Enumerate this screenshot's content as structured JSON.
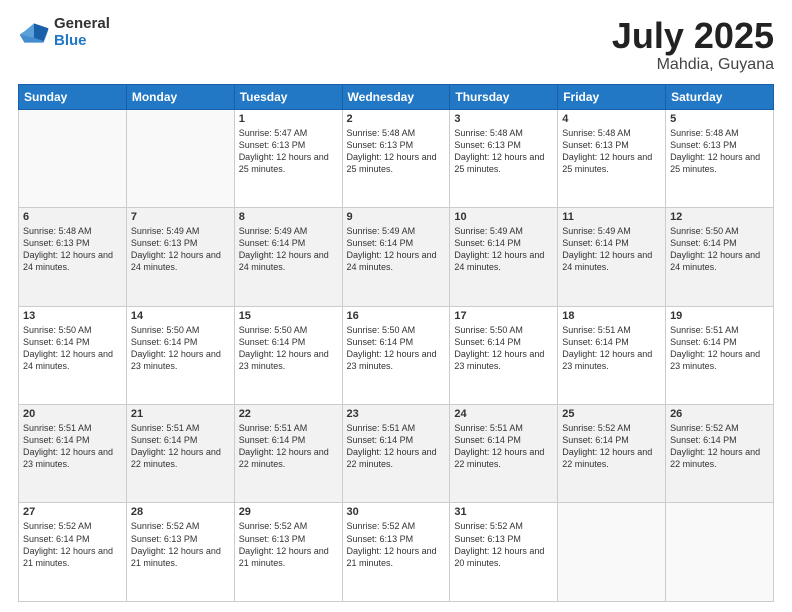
{
  "logo": {
    "general": "General",
    "blue": "Blue"
  },
  "title": {
    "month_year": "July 2025",
    "location": "Mahdia, Guyana"
  },
  "weekdays": [
    "Sunday",
    "Monday",
    "Tuesday",
    "Wednesday",
    "Thursday",
    "Friday",
    "Saturday"
  ],
  "weeks": [
    [
      {
        "day": "",
        "info": ""
      },
      {
        "day": "",
        "info": ""
      },
      {
        "day": "1",
        "info": "Sunrise: 5:47 AM\nSunset: 6:13 PM\nDaylight: 12 hours and 25 minutes."
      },
      {
        "day": "2",
        "info": "Sunrise: 5:48 AM\nSunset: 6:13 PM\nDaylight: 12 hours and 25 minutes."
      },
      {
        "day": "3",
        "info": "Sunrise: 5:48 AM\nSunset: 6:13 PM\nDaylight: 12 hours and 25 minutes."
      },
      {
        "day": "4",
        "info": "Sunrise: 5:48 AM\nSunset: 6:13 PM\nDaylight: 12 hours and 25 minutes."
      },
      {
        "day": "5",
        "info": "Sunrise: 5:48 AM\nSunset: 6:13 PM\nDaylight: 12 hours and 25 minutes."
      }
    ],
    [
      {
        "day": "6",
        "info": "Sunrise: 5:48 AM\nSunset: 6:13 PM\nDaylight: 12 hours and 24 minutes."
      },
      {
        "day": "7",
        "info": "Sunrise: 5:49 AM\nSunset: 6:13 PM\nDaylight: 12 hours and 24 minutes."
      },
      {
        "day": "8",
        "info": "Sunrise: 5:49 AM\nSunset: 6:14 PM\nDaylight: 12 hours and 24 minutes."
      },
      {
        "day": "9",
        "info": "Sunrise: 5:49 AM\nSunset: 6:14 PM\nDaylight: 12 hours and 24 minutes."
      },
      {
        "day": "10",
        "info": "Sunrise: 5:49 AM\nSunset: 6:14 PM\nDaylight: 12 hours and 24 minutes."
      },
      {
        "day": "11",
        "info": "Sunrise: 5:49 AM\nSunset: 6:14 PM\nDaylight: 12 hours and 24 minutes."
      },
      {
        "day": "12",
        "info": "Sunrise: 5:50 AM\nSunset: 6:14 PM\nDaylight: 12 hours and 24 minutes."
      }
    ],
    [
      {
        "day": "13",
        "info": "Sunrise: 5:50 AM\nSunset: 6:14 PM\nDaylight: 12 hours and 24 minutes."
      },
      {
        "day": "14",
        "info": "Sunrise: 5:50 AM\nSunset: 6:14 PM\nDaylight: 12 hours and 23 minutes."
      },
      {
        "day": "15",
        "info": "Sunrise: 5:50 AM\nSunset: 6:14 PM\nDaylight: 12 hours and 23 minutes."
      },
      {
        "day": "16",
        "info": "Sunrise: 5:50 AM\nSunset: 6:14 PM\nDaylight: 12 hours and 23 minutes."
      },
      {
        "day": "17",
        "info": "Sunrise: 5:50 AM\nSunset: 6:14 PM\nDaylight: 12 hours and 23 minutes."
      },
      {
        "day": "18",
        "info": "Sunrise: 5:51 AM\nSunset: 6:14 PM\nDaylight: 12 hours and 23 minutes."
      },
      {
        "day": "19",
        "info": "Sunrise: 5:51 AM\nSunset: 6:14 PM\nDaylight: 12 hours and 23 minutes."
      }
    ],
    [
      {
        "day": "20",
        "info": "Sunrise: 5:51 AM\nSunset: 6:14 PM\nDaylight: 12 hours and 23 minutes."
      },
      {
        "day": "21",
        "info": "Sunrise: 5:51 AM\nSunset: 6:14 PM\nDaylight: 12 hours and 22 minutes."
      },
      {
        "day": "22",
        "info": "Sunrise: 5:51 AM\nSunset: 6:14 PM\nDaylight: 12 hours and 22 minutes."
      },
      {
        "day": "23",
        "info": "Sunrise: 5:51 AM\nSunset: 6:14 PM\nDaylight: 12 hours and 22 minutes."
      },
      {
        "day": "24",
        "info": "Sunrise: 5:51 AM\nSunset: 6:14 PM\nDaylight: 12 hours and 22 minutes."
      },
      {
        "day": "25",
        "info": "Sunrise: 5:52 AM\nSunset: 6:14 PM\nDaylight: 12 hours and 22 minutes."
      },
      {
        "day": "26",
        "info": "Sunrise: 5:52 AM\nSunset: 6:14 PM\nDaylight: 12 hours and 22 minutes."
      }
    ],
    [
      {
        "day": "27",
        "info": "Sunrise: 5:52 AM\nSunset: 6:14 PM\nDaylight: 12 hours and 21 minutes."
      },
      {
        "day": "28",
        "info": "Sunrise: 5:52 AM\nSunset: 6:13 PM\nDaylight: 12 hours and 21 minutes."
      },
      {
        "day": "29",
        "info": "Sunrise: 5:52 AM\nSunset: 6:13 PM\nDaylight: 12 hours and 21 minutes."
      },
      {
        "day": "30",
        "info": "Sunrise: 5:52 AM\nSunset: 6:13 PM\nDaylight: 12 hours and 21 minutes."
      },
      {
        "day": "31",
        "info": "Sunrise: 5:52 AM\nSunset: 6:13 PM\nDaylight: 12 hours and 20 minutes."
      },
      {
        "day": "",
        "info": ""
      },
      {
        "day": "",
        "info": ""
      }
    ]
  ]
}
